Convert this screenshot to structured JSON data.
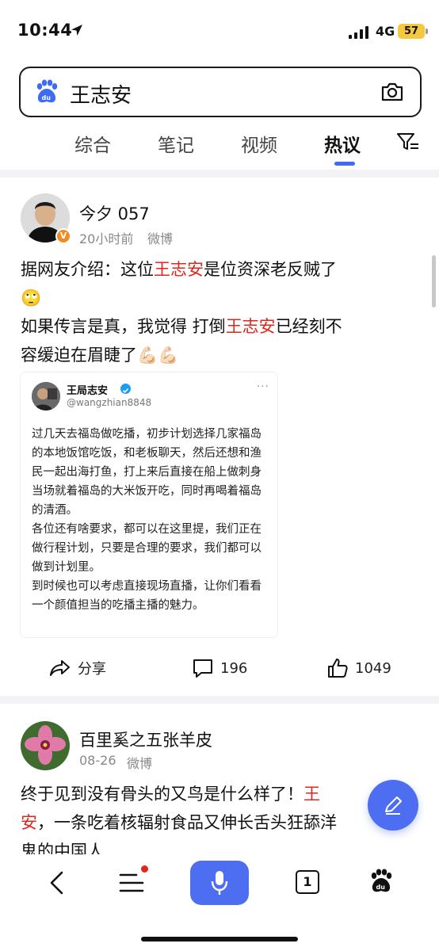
{
  "status_bar": {
    "time": "10:44",
    "network": "4G",
    "battery": "57"
  },
  "search": {
    "query": "王志安"
  },
  "tabs": [
    {
      "label": "综合"
    },
    {
      "label": "笔记"
    },
    {
      "label": "视频"
    },
    {
      "label": "热议",
      "active": true
    }
  ],
  "posts": [
    {
      "username": "今夕 057",
      "time": "20小时前",
      "source": "微博",
      "lines": [
        {
          "a": "据网友介绍：这位",
          "h": "王志安",
          "b": "是位资深老反贼了"
        },
        {
          "a": "🙄",
          "h": "",
          "b": ""
        },
        {
          "a": "如果传言是真，我觉得 打倒",
          "h": "王志安",
          "b": "已经刻不"
        },
        {
          "a": "容缓迫在眉睫了💪🏻💪🏻",
          "h": "",
          "b": ""
        }
      ],
      "embed": {
        "name": "王局志安",
        "handle": "@wangzhian8848",
        "paragraphs": [
          "过几天去福岛做吃播，初步计划选择几家福岛的本地饭馆吃饭，和老板聊天，然后还想和渔民一起出海打鱼，打上来后直接在船上做刺身当场就着福岛的大米饭开吃，同时再喝着福岛的清酒。",
          "各位还有啥要求，都可以在这里提，我们正在做行程计划，只要是合理的要求，我们都可以做到计划里。",
          "到时候也可以考虑直接现场直播，让你们看看一个颜值担当的吃播主播的魅力。"
        ]
      },
      "actions": {
        "share": "分享",
        "comments": "196",
        "likes": "1049"
      }
    },
    {
      "username": "百里奚之五张羊皮",
      "time": "08-26",
      "source": "微博",
      "lines": [
        {
          "a": "终于见到没有骨头的又鸟是什么样了！",
          "h": "王",
          "b": ""
        },
        {
          "a": "",
          "h": "安",
          "b": "，一条吃着核辐射食品又伸长舌头狂舔洋"
        },
        {
          "a": "鬼的中国人",
          "h": "",
          "b": ""
        }
      ]
    }
  ],
  "bottom_nav": {
    "tab_count": "1"
  },
  "colors": {
    "accent": "#4e6ef2",
    "highlight": "#e0251c",
    "battery": "#f5c842"
  }
}
